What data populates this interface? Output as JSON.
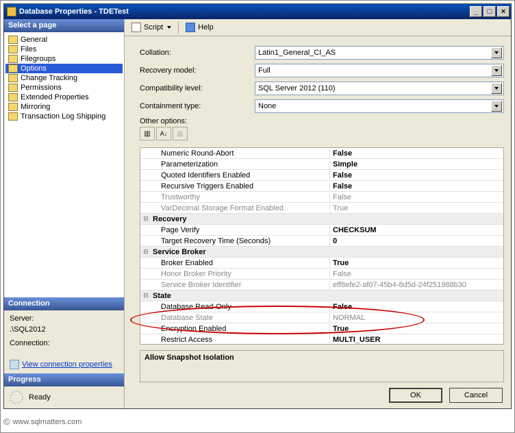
{
  "window": {
    "title": "Database Properties - TDETest"
  },
  "left": {
    "select_page": "Select a page",
    "pages": [
      "General",
      "Files",
      "Filegroups",
      "Options",
      "Change Tracking",
      "Permissions",
      "Extended Properties",
      "Mirroring",
      "Transaction Log Shipping"
    ],
    "selected_index": 3,
    "connection_h": "Connection",
    "server_lbl": "Server:",
    "server_val": ".\\SQL2012",
    "conn_lbl": "Connection:",
    "view_conn": "View connection properties",
    "progress_h": "Progress",
    "progress_txt": "Ready"
  },
  "toolbar": {
    "script": "Script",
    "help": "Help"
  },
  "form": {
    "collation_lbl": "Collation:",
    "collation_val": "Latin1_General_CI_AS",
    "recovery_lbl": "Recovery model:",
    "recovery_val": "Full",
    "compat_lbl": "Compatibility level:",
    "compat_val": "SQL Server 2012 (110)",
    "contain_lbl": "Containment type:",
    "contain_val": "None",
    "other_lbl": "Other options:"
  },
  "grid": [
    {
      "t": "row",
      "name": "Numeric Round-Abort",
      "val": "False",
      "bold": true
    },
    {
      "t": "row",
      "name": "Parameterization",
      "val": "Simple",
      "bold": true
    },
    {
      "t": "row",
      "name": "Quoted Identifiers Enabled",
      "val": "False",
      "bold": true
    },
    {
      "t": "row",
      "name": "Recursive Triggers Enabled",
      "val": "False",
      "bold": true
    },
    {
      "t": "row",
      "name": "Trustworthy",
      "val": "False",
      "ro": true
    },
    {
      "t": "row",
      "name": "VarDecimal Storage Format Enabled",
      "val": "True",
      "ro": true
    },
    {
      "t": "cat",
      "name": "Recovery"
    },
    {
      "t": "row",
      "name": "Page Verify",
      "val": "CHECKSUM",
      "bold": true
    },
    {
      "t": "row",
      "name": "Target Recovery Time (Seconds)",
      "val": "0",
      "bold": true
    },
    {
      "t": "cat",
      "name": "Service Broker"
    },
    {
      "t": "row",
      "name": "Broker Enabled",
      "val": "True",
      "bold": true
    },
    {
      "t": "row",
      "name": "Honor Broker Priority",
      "val": "False",
      "ro": true
    },
    {
      "t": "row",
      "name": "Service Broker Identifier",
      "val": "eff8efe2-af07-45b4-8d5d-24f251988b30",
      "ro": true
    },
    {
      "t": "cat",
      "name": "State"
    },
    {
      "t": "row",
      "name": "Database Read-Only",
      "val": "False",
      "bold": true
    },
    {
      "t": "row",
      "name": "Database State",
      "val": "NORMAL",
      "ro": true
    },
    {
      "t": "row",
      "name": "Encryption Enabled",
      "val": "True",
      "bold": true
    },
    {
      "t": "row",
      "name": "Restrict Access",
      "val": "MULTI_USER",
      "bold": true
    }
  ],
  "desc": {
    "title": "Allow Snapshot Isolation"
  },
  "buttons": {
    "ok": "OK",
    "cancel": "Cancel"
  },
  "footer": "www.sqlmatters.com"
}
